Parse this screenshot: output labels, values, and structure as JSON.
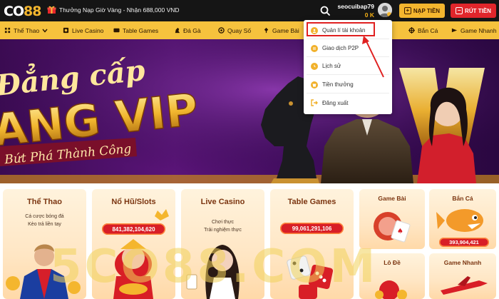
{
  "header": {
    "logo_text": "CO88",
    "promo_text": "Thưởng Nạp Giờ Vàng - Nhận 688,000 VND",
    "username": "seocuibap79",
    "balance": "0 K",
    "deposit_label": "NẠP TIỀN",
    "withdraw_label": "RÚT TIỀN"
  },
  "nav": {
    "items": [
      {
        "label": "Thể Thao",
        "icon": "sports-icon"
      },
      {
        "label": "Live Casino",
        "icon": "live-casino-icon"
      },
      {
        "label": "Table Games",
        "icon": "table-games-icon"
      },
      {
        "label": "Đá Gà",
        "icon": "cockfight-icon"
      },
      {
        "label": "Quay Số",
        "icon": "lottery-icon"
      },
      {
        "label": "Game Bài",
        "icon": "cards-icon"
      },
      {
        "label": "Bắn Cá",
        "icon": "fish-icon"
      },
      {
        "label": "Game Nhanh",
        "icon": "fast-game-icon"
      }
    ]
  },
  "account_menu": {
    "items": [
      {
        "label": "Quản lí tài khoản",
        "icon": "account-icon"
      },
      {
        "label": "Giao dịch P2P",
        "icon": "p2p-icon"
      },
      {
        "label": "Lịch sử",
        "icon": "history-icon"
      },
      {
        "label": "Tiền thưởng",
        "icon": "bonus-icon"
      },
      {
        "label": "Đăng xuất",
        "icon": "logout-icon"
      }
    ]
  },
  "banner": {
    "title_line1": "Đẳng cấp",
    "title_line2": "ANG VIP",
    "slogan": "Bứt Phá Thành Công"
  },
  "cards": {
    "sports": {
      "title": "Thể Thao",
      "sub1": "Cá cược bóng đá",
      "sub2": "Kèo trả liền tay"
    },
    "slots": {
      "title": "Nổ Hũ/Slots",
      "jackpot": "841,382,104,620"
    },
    "live_casino": {
      "title": "Live Casino",
      "sub1": "Chơi thực",
      "sub2": "Trải nghiệm thực"
    },
    "table_games": {
      "title": "Table Games",
      "jackpot": "99,061,291,106"
    },
    "game_bai": {
      "title": "Game Bài"
    },
    "ban_ca": {
      "title": "Bắn Cá",
      "jackpot": "393,904,421"
    },
    "lo_de": {
      "title": "Lô Đề"
    },
    "game_nhanh": {
      "title": "Game Nhanh"
    }
  },
  "watermark": "5CO88.COM",
  "colors": {
    "topbar": "#151515",
    "nav": "#f6c23d",
    "deposit": "#f4b62e",
    "withdraw": "#e0262b",
    "balance": "#f5b016",
    "highlight": "#e02020"
  }
}
